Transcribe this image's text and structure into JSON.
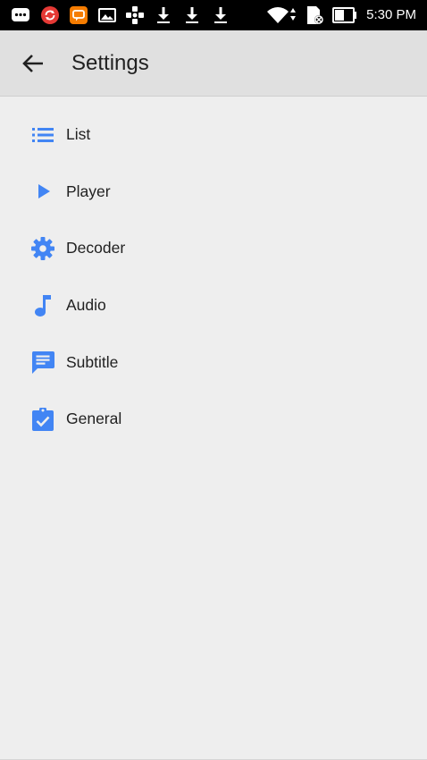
{
  "status_bar": {
    "time": "5:30 PM",
    "icons": [
      "message-icon",
      "sync-app-icon",
      "chat-app-icon",
      "gallery-icon",
      "game-controller-icon",
      "download-icon",
      "download-icon",
      "download-icon",
      "wifi-icon",
      "no-sim-icon",
      "battery-icon"
    ]
  },
  "header": {
    "title": "Settings",
    "back_icon": "arrow-back-icon"
  },
  "menu": {
    "accent_color": "#4285f4",
    "items": [
      {
        "label": "List",
        "icon": "list-icon"
      },
      {
        "label": "Player",
        "icon": "play-icon"
      },
      {
        "label": "Decoder",
        "icon": "gear-icon"
      },
      {
        "label": "Audio",
        "icon": "music-note-icon"
      },
      {
        "label": "Subtitle",
        "icon": "subtitle-icon"
      },
      {
        "label": "General",
        "icon": "assignment-check-icon"
      }
    ]
  }
}
